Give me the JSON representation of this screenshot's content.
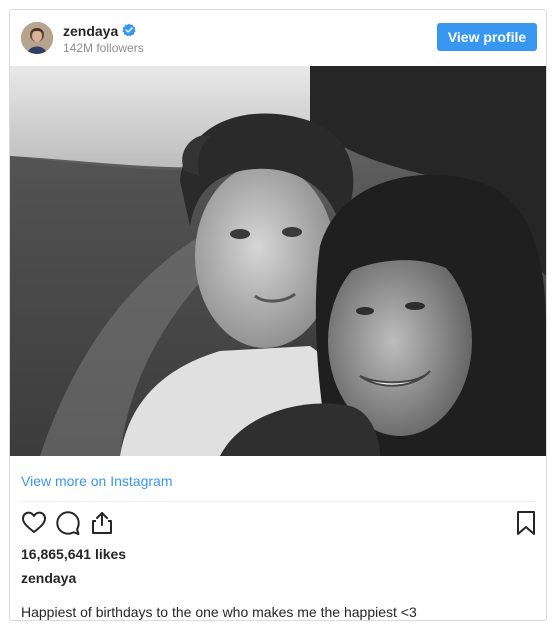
{
  "header": {
    "username": "zendaya",
    "followers": "142M followers",
    "view_profile_label": "View profile",
    "verified_icon": "verified-badge-icon",
    "accent": "#3897f0"
  },
  "post": {
    "photo_description": "black-and-white-photo",
    "view_more_label": "View more on Instagram",
    "actions": {
      "like_icon": "heart-icon",
      "comment_icon": "comment-icon",
      "share_icon": "share-icon",
      "save_icon": "bookmark-icon"
    },
    "likes": "16,865,641 likes",
    "caption_user": "zendaya",
    "caption": "Happiest of birthdays to the one who makes me the happiest <3"
  }
}
